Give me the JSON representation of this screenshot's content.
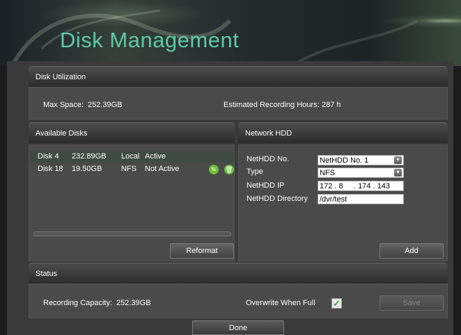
{
  "page": {
    "title": "Disk Management"
  },
  "disk_utilization": {
    "header": "Disk Utilization",
    "max_space_label": "Max Space:",
    "max_space_value": "252.39GB",
    "estimated_hours_label": "Estimated Recording Hours:",
    "estimated_hours_value": "287 h"
  },
  "available_disks": {
    "header": "Available Disks",
    "disks": [
      {
        "name": "Disk 4",
        "capacity": "232.89GB",
        "type": "Local",
        "status": "Active",
        "selected": true
      },
      {
        "name": "Disk 18",
        "capacity": "19.50GB",
        "type": "NFS",
        "status": "Not Active",
        "selected": false,
        "actions": [
          "edit-icon",
          "delete-icon"
        ]
      }
    ],
    "reformat_label": "Reformat"
  },
  "network_hdd": {
    "header": "Network HDD",
    "fields": {
      "netHDD_no_label": "NetHDD No.",
      "netHDD_no_value": "NetHDD No. 1",
      "type_label": "Type",
      "type_value": "NFS",
      "ip_label": "NetHDD IP",
      "ip_octets": [
        "172",
        "8",
        "174",
        "143"
      ],
      "directory_label": "NetHDD Directory",
      "directory_value": "/dvr/test"
    },
    "add_label": "Add"
  },
  "status": {
    "header": "Status",
    "capacity_label": "Recording Capacity:",
    "capacity_value": "252.39GB",
    "overwrite_label": "Overwrite When Full",
    "overwrite_checked": true,
    "save_label": "Save"
  },
  "footer": {
    "done_label": "Done"
  },
  "colors": {
    "title": "#5dc9a6",
    "selected_row": "#3f4a43",
    "edit_icon": "#6fbf3a",
    "delete_icon": "#6fbf3a"
  }
}
